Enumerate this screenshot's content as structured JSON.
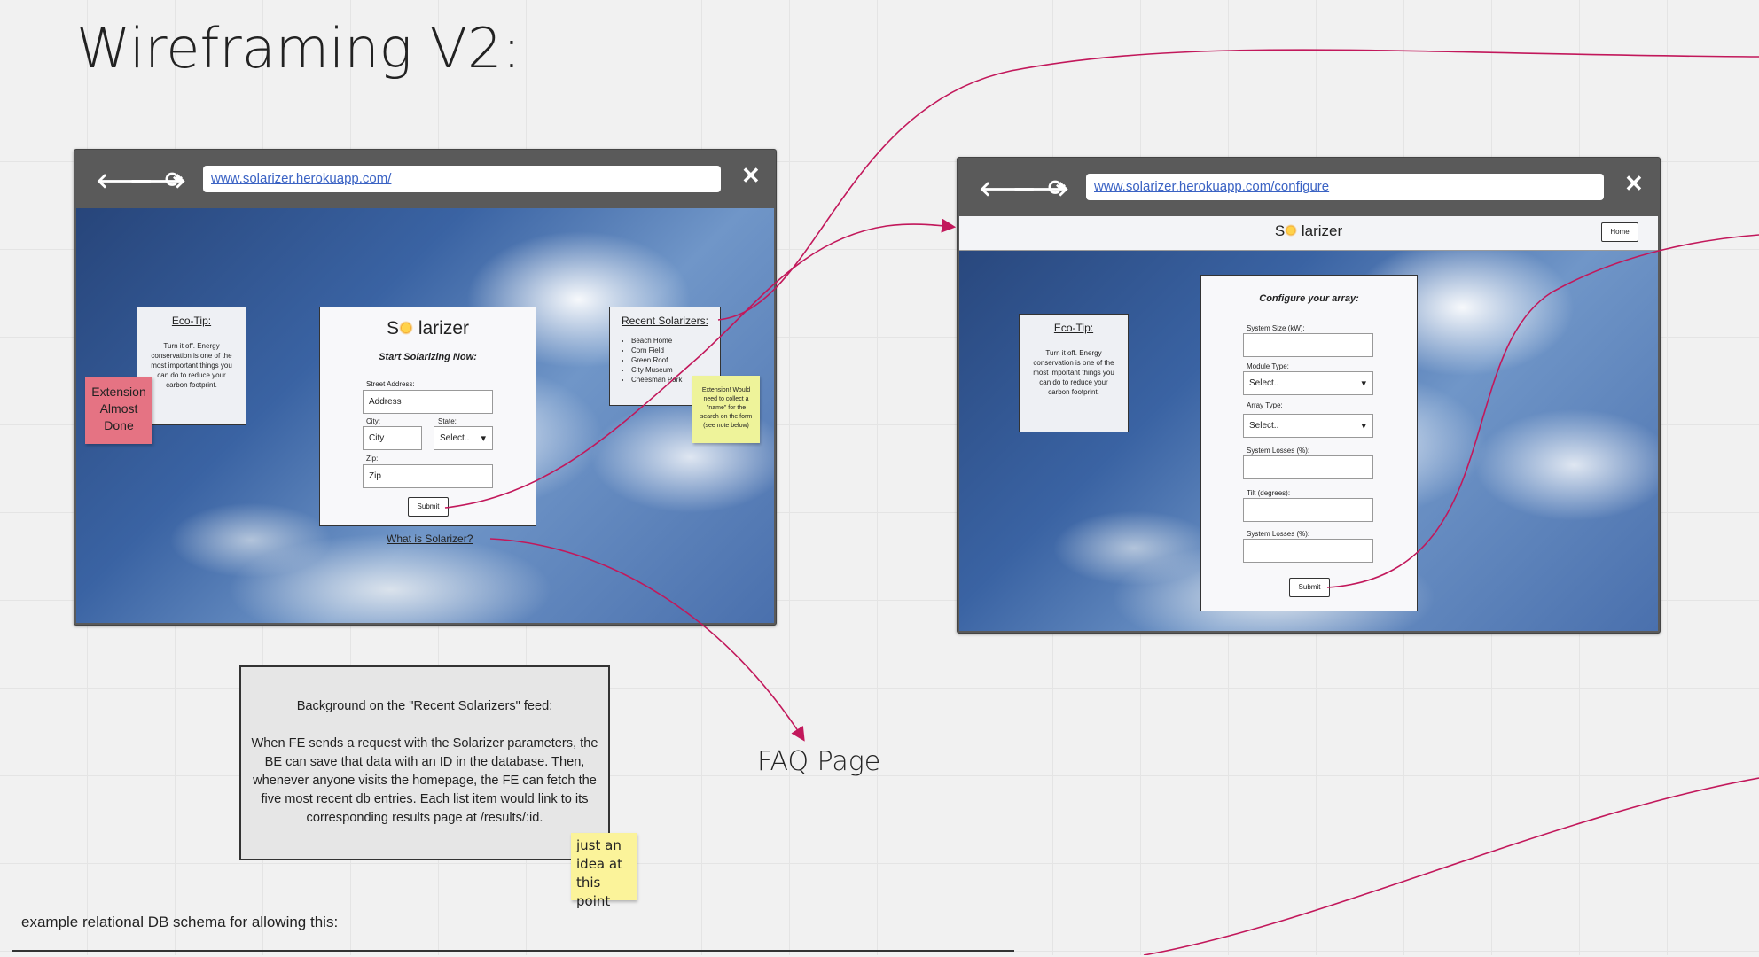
{
  "page_title": "Wireframing V2:",
  "home_browser": {
    "url": "www.solarizer.herokuapp.com/",
    "nav": {
      "back": "🡐",
      "forward": "🡒",
      "reload": "⟳",
      "close": "✕"
    },
    "eco_tip": {
      "title": "Eco-Tip:",
      "text": "Turn it off. Energy conservation is one of the most important things you can do to reduce your carbon footprint."
    },
    "form": {
      "logo_left": "S",
      "logo_right": "larizer",
      "heading": "Start Solarizing Now:",
      "street_label": "Street Address:",
      "street_value": "Address",
      "city_label": "City:",
      "city_value": "City",
      "state_label": "State:",
      "state_value": "Select..",
      "zip_label": "Zip:",
      "zip_value": "Zip",
      "submit": "Submit"
    },
    "recent": {
      "title": "Recent Solarizers:",
      "items": [
        "Beach Home",
        "Corn Field",
        "Green Roof",
        "City Museum",
        "Cheesman Park"
      ]
    },
    "what_link": "What is Solarizer?"
  },
  "configure_browser": {
    "url": "www.solarizer.herokuapp.com/configure",
    "nav": {
      "back": "🡐",
      "forward": "🡒",
      "reload": "⟳",
      "close": "✕"
    },
    "logo_left": "S",
    "logo_right": "larizer",
    "home_button": "Home",
    "eco_tip": {
      "title": "Eco-Tip:",
      "text": "Turn it off. Energy conservation is one of the most important things you can do to reduce your carbon footprint."
    },
    "form": {
      "heading": "Configure your array:",
      "system_size_label": "System Size (kW):",
      "module_type_label": "Module Type:",
      "module_type_value": "Select..",
      "array_type_label": "Array Type:",
      "array_type_value": "Select..",
      "system_losses_label": "System Losses (%):",
      "tilt_label": "Tilt (degrees):",
      "system_losses_label_2": "System Losses (%):",
      "submit": "Submit"
    }
  },
  "stickies": {
    "extension_done": "Extension Almost Done",
    "extension_note": "Extension! Would need to collect a \"name\" for the search on the form (see note below)",
    "idea_note": "just an idea at this point"
  },
  "background_note": {
    "title": "Background on the \"Recent Solarizers\" feed:",
    "body": "When FE sends a request with the Solarizer parameters, the BE can save that data with an ID in the database. Then, whenever anyone visits the homepage, the FE can fetch the five most recent db entries. Each list item would link to its corresponding results page at /results/:id."
  },
  "faq_label": "FAQ Page",
  "schema_caption": "example relational DB schema for allowing this:",
  "colors": {
    "arrow": "#c2185b",
    "sticky_pink": "#e57383",
    "sticky_yellow": "#f4f6a0",
    "sticky_yellow_2": "#fbf39a"
  }
}
